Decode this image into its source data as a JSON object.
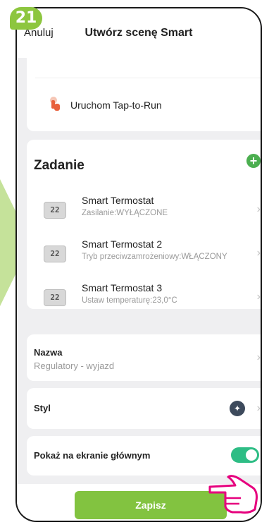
{
  "step": "21",
  "header": {
    "back_label": "Anuluj",
    "title": "Utwórz scenę Smart"
  },
  "run": {
    "label": "Uruchom Tap-to-Run",
    "icon": "tap-hand-icon"
  },
  "tasks": {
    "title": "Zadanie",
    "add_icon": "+",
    "items": [
      {
        "name": "Smart Termostat",
        "detail": "Zasilanie:WYŁĄCZONE",
        "icon_text": "22"
      },
      {
        "name": "Smart Termostat 2",
        "detail": "Tryb przeciwzamrożeniowy:WŁĄCZONY",
        "icon_text": "22"
      },
      {
        "name": "Smart Termostat 3",
        "detail": "Ustaw temperaturę:23,0°C",
        "icon_text": "22"
      }
    ]
  },
  "name_row": {
    "label": "Nazwa",
    "value": "Regulatory - wyjazd"
  },
  "style_row": {
    "label": "Styl"
  },
  "show_row": {
    "label": "Pokaż na ekranie głównym",
    "toggle_on": true
  },
  "save_label": "Zapisz",
  "colors": {
    "accent_green": "#82c340",
    "toggle_green": "#2ebd85",
    "hand_pink": "#e6007e"
  }
}
